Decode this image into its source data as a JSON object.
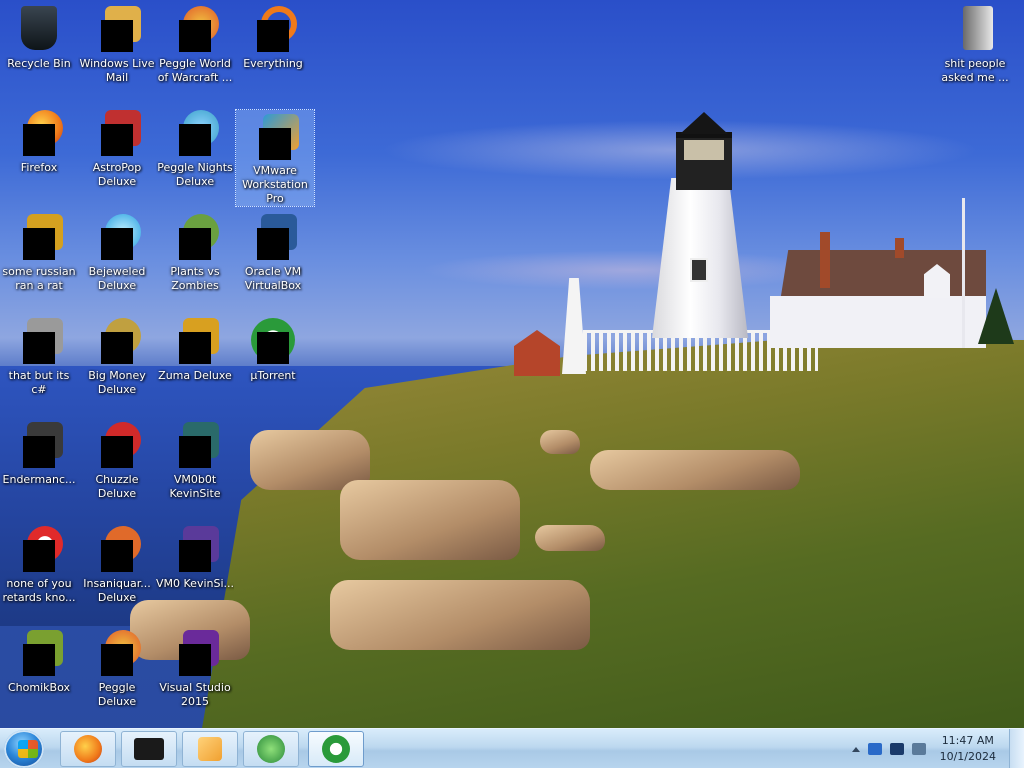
{
  "desktop": {
    "icons": [
      {
        "label": "Recycle Bin",
        "icon": "recycle-bin-icon",
        "color": "#1f2a33"
      },
      {
        "label": "Windows Live Mail",
        "icon": "mail-icon",
        "color": "#e0b04a"
      },
      {
        "label": "Peggle World of Warcraft ...",
        "icon": "game-icon",
        "color": "#e05a2a"
      },
      {
        "label": "Everything",
        "icon": "search-icon",
        "color": "#f07a1a"
      },
      {
        "label": "Firefox",
        "icon": "firefox-icon",
        "color": "#f07a1a"
      },
      {
        "label": "AstroPop Deluxe",
        "icon": "game-icon",
        "color": "#c03030"
      },
      {
        "label": "Peggle Nights Deluxe",
        "icon": "game-icon",
        "color": "#3aa0c8"
      },
      {
        "label": "VMware Workstation Pro",
        "icon": "vmware-icon",
        "color": "#2d9ad8"
      },
      {
        "label": "some russian ran a rat",
        "icon": "file-icon",
        "color": "#d4a020"
      },
      {
        "label": "Bejeweled Deluxe",
        "icon": "game-icon",
        "color": "#2aa0e0"
      },
      {
        "label": "Plants vs Zombies",
        "icon": "game-icon",
        "color": "#6aa040"
      },
      {
        "label": "Oracle VM VirtualBox",
        "icon": "virtualbox-icon",
        "color": "#2a5a9a"
      },
      {
        "label": "that but its c#",
        "icon": "file-icon",
        "color": "#9a9a9a"
      },
      {
        "label": "Big Money Deluxe",
        "icon": "game-icon",
        "color": "#c0a040"
      },
      {
        "label": "Zuma Deluxe",
        "icon": "game-icon",
        "color": "#d8a020"
      },
      {
        "label": "µTorrent",
        "icon": "utorrent-icon",
        "color": "#2a9a3a"
      },
      {
        "label": "Endermanc...",
        "icon": "file-icon",
        "color": "#3a3a3a"
      },
      {
        "label": "Chuzzle Deluxe",
        "icon": "game-icon",
        "color": "#d02a2a"
      },
      {
        "label": "VM0b0t KevinSite",
        "icon": "folder-icon",
        "color": "#2a6a6a"
      },
      {
        "label": "none of you retards kno...",
        "icon": "file-icon",
        "color": "#e02a2a"
      },
      {
        "label": "Insaniquar... Deluxe",
        "icon": "game-icon",
        "color": "#e06a2a"
      },
      {
        "label": "VM0 KevinSi...",
        "icon": "folder-icon",
        "color": "#5a3a9a"
      },
      {
        "label": "ChomikBox",
        "icon": "chomikbox-icon",
        "color": "#7aa030"
      },
      {
        "label": "Peggle Deluxe",
        "icon": "game-icon",
        "color": "#e05a2a"
      },
      {
        "label": "Visual Studio 2015",
        "icon": "visual-studio-icon",
        "color": "#6a2a9a"
      },
      {
        "label": "shit people asked me ...",
        "icon": "folder-icon",
        "color": "#d8d8d8"
      }
    ]
  },
  "taskbar": {
    "pinned": [
      {
        "name": "firefox",
        "icon": "firefox-icon",
        "color": "#f07a1a"
      },
      {
        "name": "terminal",
        "icon": "terminal-icon",
        "color": "#1a1a1a"
      },
      {
        "name": "media-player",
        "icon": "media-player-icon",
        "color": "#f0a030"
      },
      {
        "name": "internet-download-manager",
        "icon": "download-icon",
        "color": "#2a8a3a"
      },
      {
        "name": "utorrent",
        "icon": "utorrent-icon",
        "color": "#2a9a3a"
      }
    ],
    "clock": {
      "time": "11:47 AM",
      "date": "10/1/2024"
    }
  }
}
